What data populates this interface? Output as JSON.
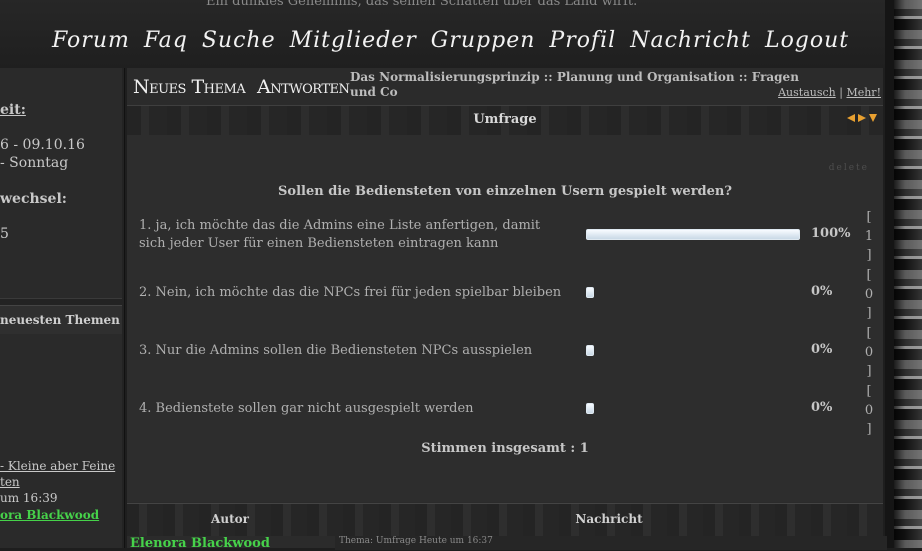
{
  "header": {
    "tagline": "Ein dunkles Geheimnis, das seinen Schatten über das Land wirft.",
    "nav": [
      "Forum",
      "Faq",
      "Suche",
      "Mitglieder",
      "Gruppen",
      "Profil",
      "Nachricht",
      "Logout"
    ]
  },
  "sidebar": {
    "time_label": "eit:",
    "date_range": "6 - 09.10.16",
    "day_range": "- Sonntag",
    "change_label": "wechsel:",
    "change_value": "5",
    "newest_topics": "neuesten Themen",
    "topic_link": "- Kleine aber Feine",
    "topic_link2": "ten",
    "topic_time": "um 16:39",
    "topic_author": "ora Blackwood"
  },
  "topbar": {
    "new_topic": "Neues Thema",
    "reply": "Antworten",
    "title": "Das Normalisierungsprinzip :: Planung und Organisation :: Fragen und Co",
    "link_exchange": "Austausch",
    "separator": "|",
    "link_more": "Mehr!"
  },
  "poll": {
    "header": "Umfrage",
    "delete": "delete",
    "question": "Sollen die Bediensteten von einzelnen Usern gespielt werden?",
    "options": [
      {
        "text": "1. ja, ich möchte das die Admins eine Liste anfertigen, damit sich jeder User für einen Bediensteten eintragen kann",
        "percent": "100%",
        "votes": "1",
        "fraction": 1.0
      },
      {
        "text": "2. Nein, ich möchte das die NPCs frei für jeden spielbar bleiben",
        "percent": "0%",
        "votes": "0",
        "fraction": 0.0
      },
      {
        "text": "3. Nur die Admins sollen die Bediensteten NPCs ausspielen",
        "percent": "0%",
        "votes": "0",
        "fraction": 0.0
      },
      {
        "text": "4. Bedienstete sollen gar nicht ausgespielt werden",
        "percent": "0%",
        "votes": "0",
        "fraction": 0.0
      }
    ],
    "total": "Stimmen insgesamt : 1"
  },
  "posts": {
    "col_author": "Autor",
    "col_message": "Nachricht",
    "author": "Elenora Blackwood",
    "meta": "Thema: Umfrage   Heute um 16:37"
  }
}
